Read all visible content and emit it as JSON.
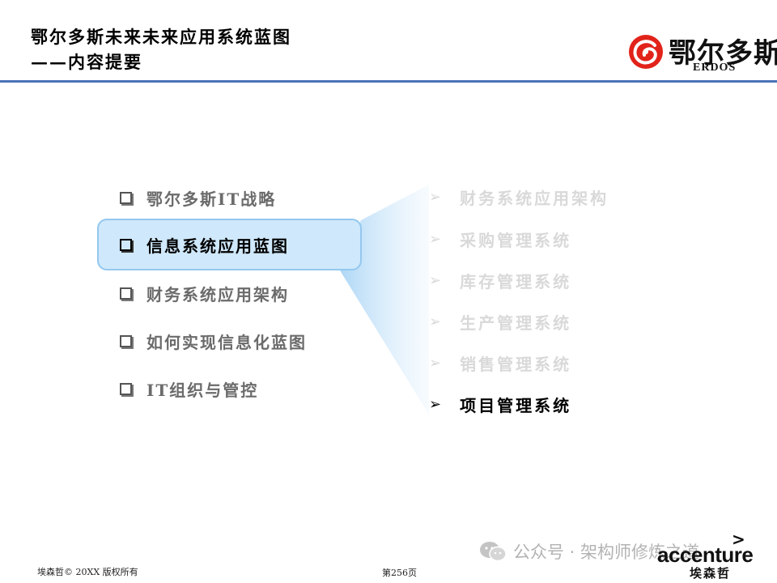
{
  "header": {
    "title": "鄂尔多斯未来未来应用系统蓝图",
    "subtitle": "——内容提要"
  },
  "logo": {
    "brand_cn": "鄂尔多斯",
    "brand_en": "ERDOS",
    "color": "#e2231a"
  },
  "left_menu": {
    "items": [
      "鄂尔多斯IT战略",
      "信息系统应用蓝图",
      "财务系统应用架构",
      "如何实现信息化蓝图",
      "IT组织与管控"
    ],
    "selected": "信息系统应用蓝图",
    "bullet_icon": "square-bullet-icon"
  },
  "right_menu": {
    "items": [
      "财务系统应用架构",
      "采购管理系统",
      "库存管理系统",
      "生产管理系统",
      "销售管理系统",
      "项目管理系统"
    ],
    "active": "项目管理系统",
    "bullet_icon": "arrow-bullet-icon"
  },
  "footer": {
    "copyright": "埃森哲©   20XX 版权所有",
    "page": "第256页",
    "watermark": "公众号 · 架构师修炼之道",
    "company_en": "accenture",
    "company_cn": "埃森哲"
  },
  "colors": {
    "rule": "#4a72b8",
    "highlight_fill": "#cfe8fb",
    "highlight_border": "#94c8ef",
    "inactive_text": "#6b6b6b",
    "faded_text": "#d9d9d9"
  }
}
